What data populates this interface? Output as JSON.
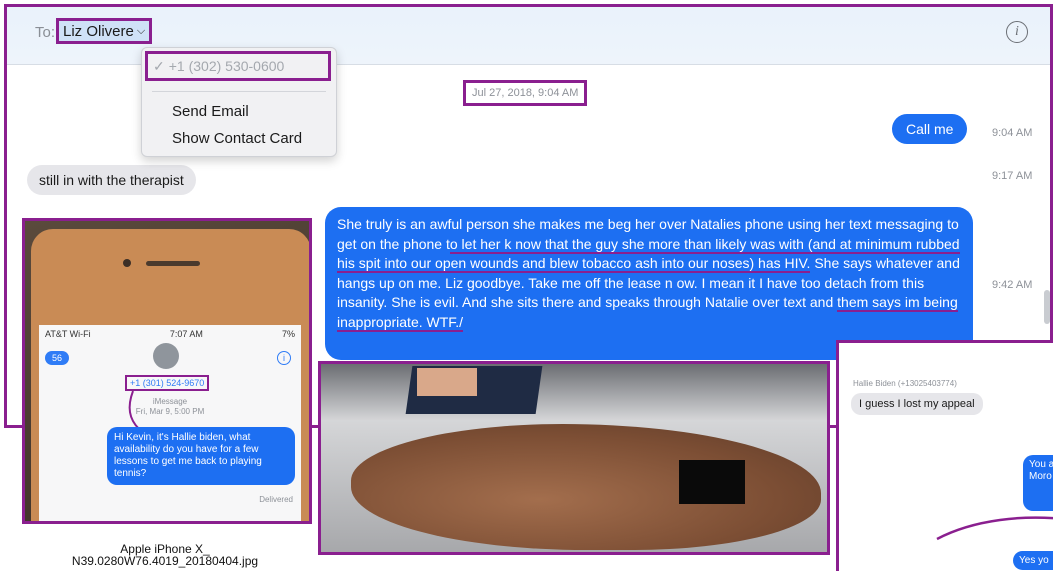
{
  "header": {
    "to_label": "To:",
    "recipient": "Liz Olivere",
    "info_icon": "info-icon"
  },
  "dropdown": {
    "phone": "+1 (302) 530-0600",
    "items": [
      "Send Email",
      "Show Contact Card"
    ]
  },
  "conversation": {
    "timestamp": "Jul 27, 2018, 9:04 AM",
    "messages": [
      {
        "side": "out",
        "text": "Call me",
        "time": "9:04 AM"
      },
      {
        "side": "in",
        "text": "still in with the therapist",
        "time": "9:17 AM"
      },
      {
        "side": "out",
        "time": "9:42 AM",
        "segments": [
          {
            "text": "She truly is an awful person she makes me beg her over Natalies phone using her text messaging to get on the phone t",
            "u": false
          },
          {
            "text": "o let her k now that the guy she more than likely was with (and at minimum rubbed his spit into our open wounds and blew tobacco ash into our noses) has HIV.",
            "u": true
          },
          {
            "text": " She says whatever and hangs up on me. Liz goodbye. Take me off the lease n ow. I mean it I have too detach from this insanity. She is evil. And she sits there and speaks through Natalie over text and ",
            "u": false
          },
          {
            "text": "them says im being inappropriate. WTF./",
            "u": true
          }
        ]
      }
    ]
  },
  "phone_photo": {
    "status_left": "AT&T Wi-Fi",
    "status_time": "7:07 AM",
    "status_right": "7%",
    "back_badge": "56",
    "number": "+1 (301) 524-9670",
    "imessage_label": "iMessage",
    "imessage_date": "Fri, Mar 9, 5:00 PM",
    "bubble": "Hi Kevin, it's Hallie biden, what availability do you have for a few lessons to get me back to playing tennis?",
    "delivered": "Delivered",
    "caption_line1": "Apple iPhone X_",
    "caption_line2": "N39.0280W76.4019_20180404.jpg"
  },
  "right_shot": {
    "sender": "Hallie Biden (+13025403774)",
    "incoming": "I guess I lost my appeal",
    "outgoing1": "You a to fu Moro",
    "outgoing2": "Yes yo"
  },
  "colors": {
    "highlight": "#8a1f8f",
    "imessage_blue": "#1d6ff2",
    "incoming_gray": "#e6e6ea"
  }
}
